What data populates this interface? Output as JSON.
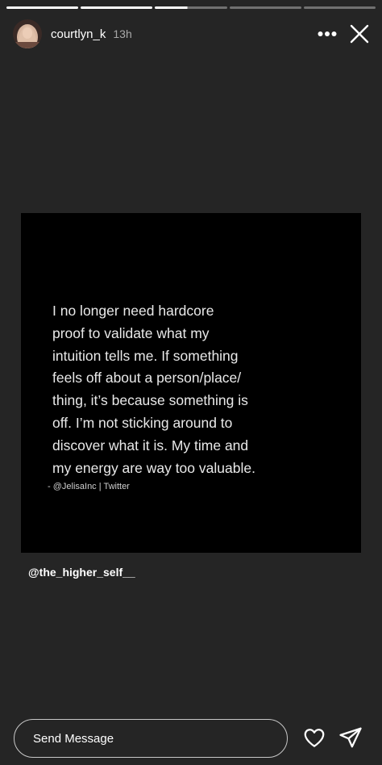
{
  "story": {
    "username": "courtlyn_k",
    "time_ago": "13h",
    "segments": [
      {
        "state": "done"
      },
      {
        "state": "done"
      },
      {
        "state": "current",
        "progress": 0.45
      },
      {
        "state": "upcoming"
      },
      {
        "state": "upcoming"
      }
    ]
  },
  "post": {
    "quote": "I no longer need hardcore\nproof to validate what my\nintuition tells me. If something\nfeels off about a person/place/\nthing, it’s because something is\noff. I’m not sticking around to\ndiscover what it is. My time and\nmy energy are way too valuable.",
    "attribution": "- @JelisaInc | Twitter"
  },
  "mention": "@the_higher_self__",
  "reply": {
    "placeholder": "Send Message"
  },
  "icons": {
    "more": "more-horizontal-icon",
    "close": "close-icon",
    "like": "heart-icon",
    "send": "send-icon"
  },
  "colors": {
    "background": "#252525",
    "post_background": "#000000",
    "text": "#ffffff"
  }
}
